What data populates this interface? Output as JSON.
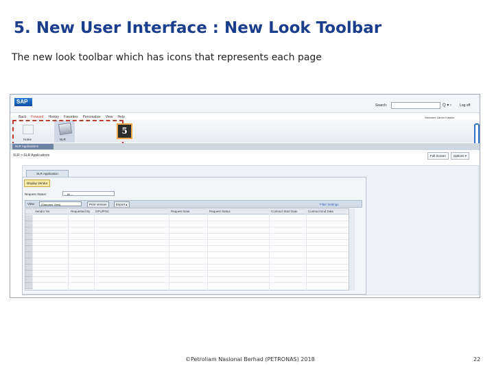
{
  "slide": {
    "title": "5. New User Interface : New Look Toolbar",
    "subtitle": "The new look toolbar which has icons that represents each page",
    "footer": "©Petroliam Nasional Berhad (PETRONAS) 2018",
    "page_number": "22"
  },
  "screenshot": {
    "logo": "SAP",
    "menu": [
      "Back",
      "Forward",
      "History",
      "Favorites",
      "Personalize",
      "View",
      "Help"
    ],
    "search_label": "Search:",
    "search_icons": "Q ▾ ›",
    "logoff": "Log off",
    "welcome": "Welcome Zahrin Kassim",
    "toolbar": {
      "home_label": "Home",
      "slr_label": "SLR"
    },
    "callout_number": "5",
    "tab": "SLR Applications",
    "breadcrumb": "SLR > SLR Applications",
    "full_screen": "Full Screen",
    "options": "Options ▾",
    "app_tab": "SLR Application",
    "display_btn": "Display Vendor",
    "request_status_label": "Request Status:",
    "request_status_value": "-- All --",
    "view_label": "View:",
    "view_value": "[Standard View]",
    "print_version": "Print Version",
    "export": "Export ▴",
    "filter_settings": "Filter Settings",
    "columns": [
      "Vendor No",
      "Requested By",
      "OPU/PSC",
      "Request Date",
      "Request Status",
      "Contract Start Date",
      "Contract End Date"
    ]
  },
  "colors": {
    "title": "#1a3e8c",
    "highlight": "#c0392b",
    "badge_border": "#f0a94a"
  }
}
